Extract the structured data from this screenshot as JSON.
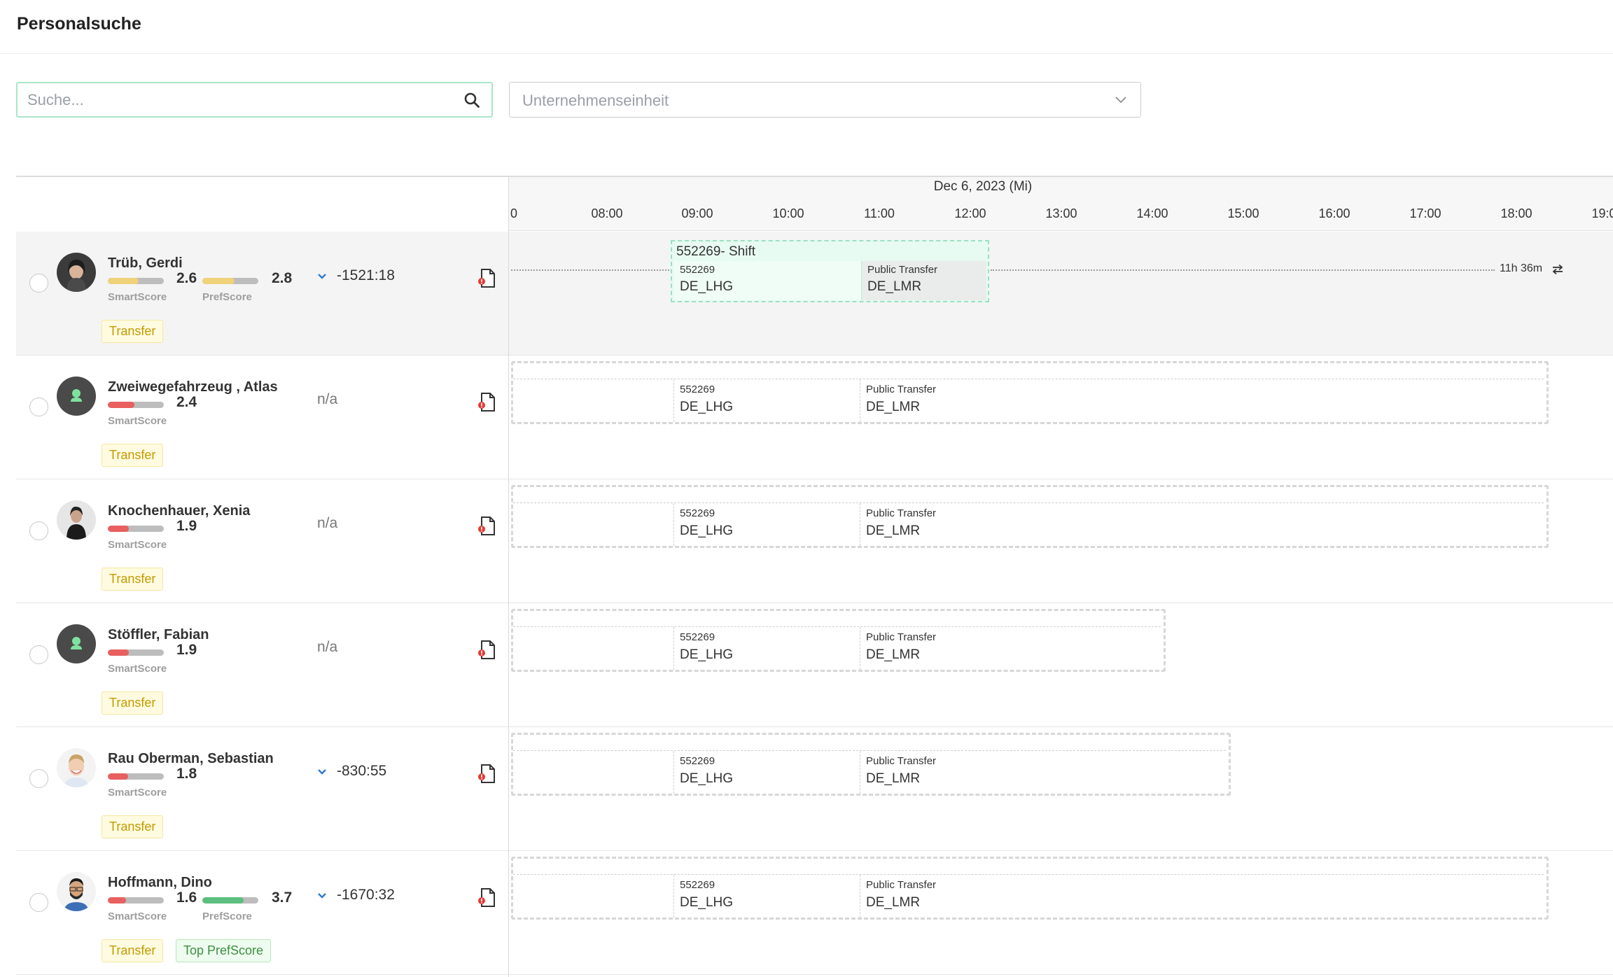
{
  "page": {
    "title": "Personalsuche"
  },
  "search": {
    "placeholder": "Suche...",
    "value": ""
  },
  "unit_select": {
    "placeholder": "Unternehmenseinheit"
  },
  "timeline": {
    "date": "Dec 6, 2023 (Mi)",
    "hours": [
      "0",
      "08:00",
      "09:00",
      "10:00",
      "11:00",
      "12:00",
      "13:00",
      "14:00",
      "15:00",
      "16:00",
      "17:00",
      "18:00",
      "19:00"
    ]
  },
  "colors": {
    "score_low": "#e8605f",
    "score_mid": "#f0d27a",
    "score_high": "#5dbf7f",
    "accent": "#a8e6c8"
  },
  "employees": [
    {
      "name": "Trüb, Gerdi",
      "smart_score": "2.6",
      "smart_fill": 0.55,
      "smart_color": "#f0d27a",
      "pref_score": "2.8",
      "pref_fill": 0.57,
      "pref_color": "#f0d27a",
      "smart_label": "SmartScore",
      "pref_label": "PrefScore",
      "delta": "-1521:18",
      "tags": [
        "Transfer"
      ]
    },
    {
      "name": "Zweiwegefahrzeug , Atlas",
      "smart_score": "2.4",
      "smart_fill": 0.48,
      "smart_color": "#e8605f",
      "smart_label": "SmartScore",
      "delta": "n/a",
      "tags": [
        "Transfer"
      ]
    },
    {
      "name": "Knochenhauer, Xenia",
      "smart_score": "1.9",
      "smart_fill": 0.38,
      "smart_color": "#e8605f",
      "smart_label": "SmartScore",
      "delta": "n/a",
      "tags": [
        "Transfer"
      ]
    },
    {
      "name": "Stöffler, Fabian",
      "smart_score": "1.9",
      "smart_fill": 0.38,
      "smart_color": "#e8605f",
      "smart_label": "SmartScore",
      "delta": "n/a",
      "tags": [
        "Transfer"
      ]
    },
    {
      "name": "Rau Oberman, Sebastian",
      "smart_score": "1.8",
      "smart_fill": 0.36,
      "smart_color": "#e8605f",
      "smart_label": "SmartScore",
      "delta": "-830:55",
      "tags": [
        "Transfer"
      ]
    },
    {
      "name": "Hoffmann, Dino",
      "smart_score": "1.6",
      "smart_fill": 0.32,
      "smart_color": "#e8605f",
      "pref_score": "3.7",
      "pref_fill": 0.74,
      "pref_color": "#5dbf7f",
      "smart_label": "SmartScore",
      "pref_label": "PrefScore",
      "delta": "-1670:32",
      "tags": [
        "Transfer",
        "Top PrefScore"
      ]
    }
  ],
  "shift": {
    "title": "552269- Shift",
    "segment_a": {
      "id": "552269",
      "code": "DE_LHG"
    },
    "segment_b": {
      "label": "Public Transfer",
      "code": "DE_LMR"
    },
    "duration": "11h 36m"
  }
}
